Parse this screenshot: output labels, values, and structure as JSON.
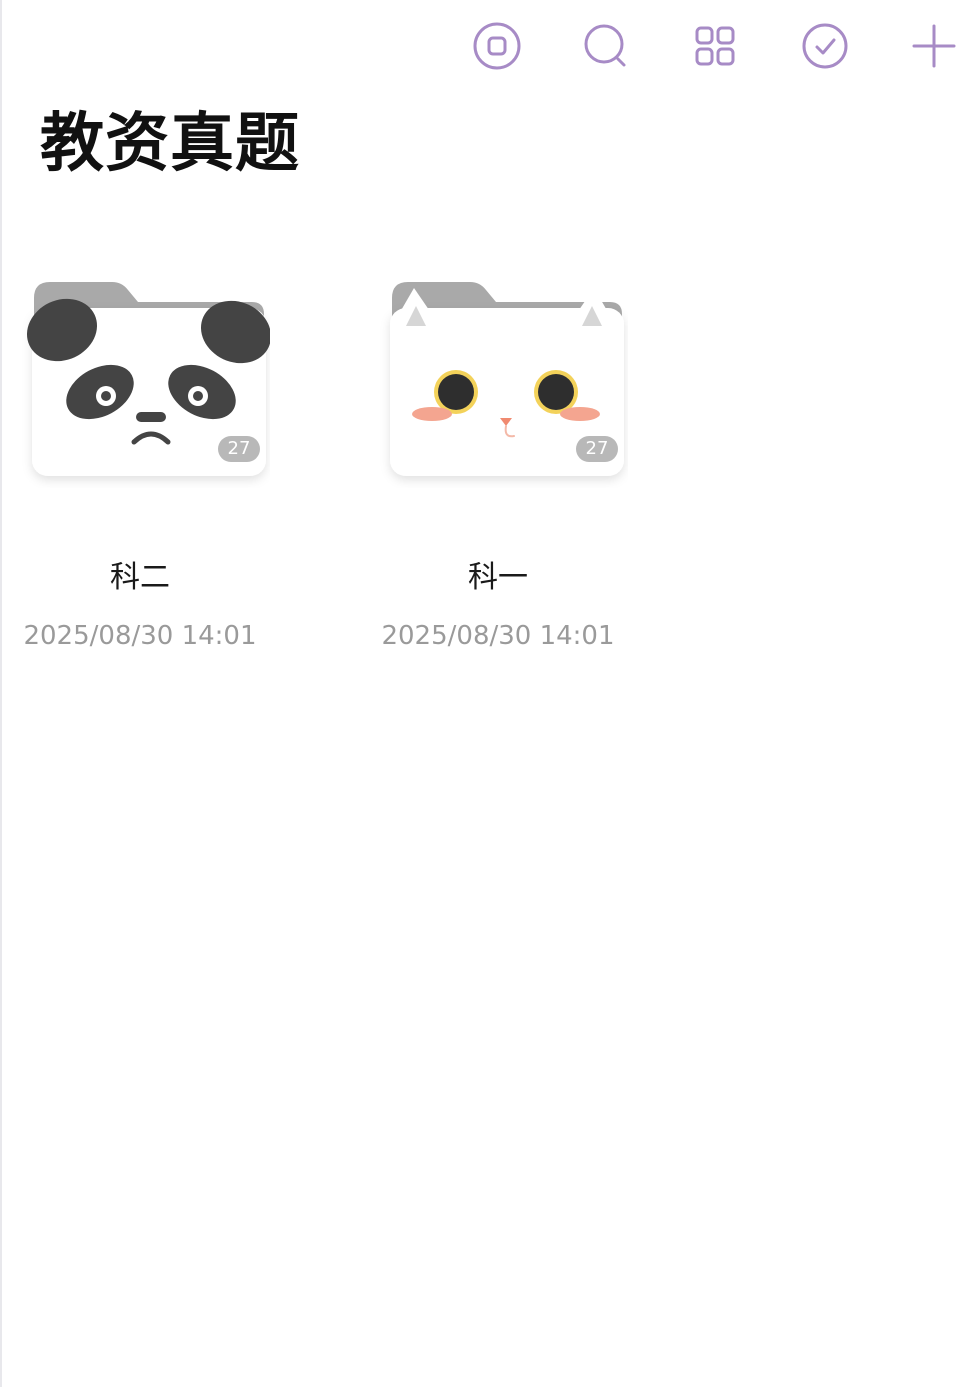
{
  "colors": {
    "accent": "#a78bc6",
    "title": "#111111",
    "date": "#9a9a9a",
    "badge": "#b8b8b8"
  },
  "toolbar": {
    "icons": [
      "stop-icon",
      "search-icon",
      "grid-view-icon",
      "select-check-icon",
      "add-icon"
    ]
  },
  "header": {
    "title": "教资真题"
  },
  "folders": [
    {
      "name": "科二",
      "date": "2025/08/30 14:01",
      "count": "27",
      "icon": "panda-folder-icon"
    },
    {
      "name": "科一",
      "date": "2025/08/30 14:01",
      "count": "27",
      "icon": "cat-folder-icon"
    }
  ]
}
